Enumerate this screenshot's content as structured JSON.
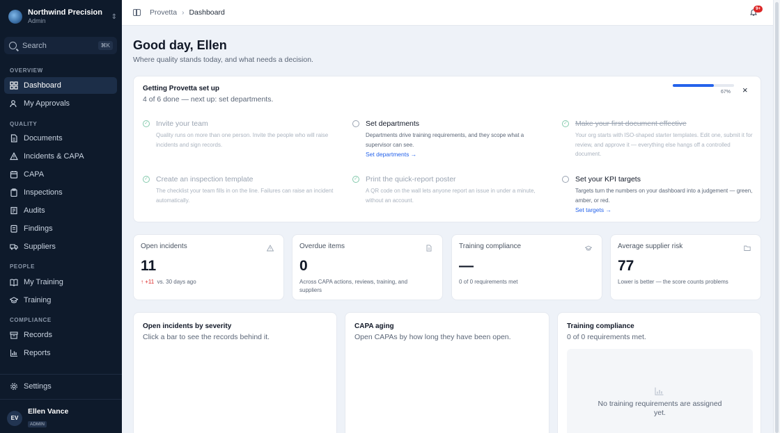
{
  "org": {
    "name": "Northwind Precision",
    "role": "Admin",
    "chevron_icon": "chevron-up-down-icon"
  },
  "search": {
    "label": "Search",
    "shortcut": "⌘K"
  },
  "nav": {
    "sections": [
      "OVERVIEW",
      "QUALITY",
      "PEOPLE",
      "COMPLIANCE"
    ],
    "items": [
      {
        "label": "Dashboard",
        "icon": "dashboard-icon",
        "active": true
      },
      {
        "label": "My Approvals",
        "icon": "user-check-icon"
      },
      {
        "label": "Documents",
        "icon": "document-icon"
      },
      {
        "label": "Incidents & CAPA",
        "icon": "warning-icon"
      },
      {
        "label": "CAPA",
        "icon": "capa-icon"
      },
      {
        "label": "Inspections",
        "icon": "clipboard-icon"
      },
      {
        "label": "Audits",
        "icon": "audit-icon"
      },
      {
        "label": "Findings",
        "icon": "findings-icon"
      },
      {
        "label": "Suppliers",
        "icon": "truck-icon"
      },
      {
        "label": "My Training",
        "icon": "book-icon"
      },
      {
        "label": "Training",
        "icon": "graduation-cap-icon"
      },
      {
        "label": "Records",
        "icon": "archive-icon"
      },
      {
        "label": "Reports",
        "icon": "bar-chart-icon"
      }
    ],
    "settings": "Settings"
  },
  "user": {
    "initials": "EV",
    "name": "Ellen Vance",
    "role": "ADMIN"
  },
  "breadcrumb": {
    "root": "Provetta",
    "separator": "›",
    "current": "Dashboard"
  },
  "notifications": {
    "badge": "9+",
    "icon": "bell-icon"
  },
  "greeting": {
    "title": "Good day, Ellen",
    "subtitle": "Where quality stands today, and what needs a decision."
  },
  "setup": {
    "title": "Getting Provetta set up",
    "subtitle": "4 of 6 done — next up: set departments.",
    "progress_percent": 67,
    "progress_label": "67%",
    "close": "×",
    "tasks": [
      {
        "title": "Invite your team",
        "desc": "Quality runs on more than one person. Invite the people who will raise incidents and sign records.",
        "done": true
      },
      {
        "title": "Set departments",
        "desc": "Departments drive training requirements, and they scope what a supervisor can see.",
        "done": false,
        "link": "Set departments →"
      },
      {
        "title": "Make your first document effective",
        "desc": "Your org starts with ISO-shaped starter templates. Edit one, submit it for review, and approve it — everything else hangs off a controlled document.",
        "done": true
      },
      {
        "title": "Create an inspection template",
        "desc": "The checklist your team fills in on the line. Failures can raise an incident automatically.",
        "done": true
      },
      {
        "title": "Print the quick-report poster",
        "desc": "A QR code on the wall lets anyone report an issue in under a minute, without an account.",
        "done": true
      },
      {
        "title": "Set your KPI targets",
        "desc": "Targets turn the numbers on your dashboard into a judgement — green, amber, or red.",
        "done": false,
        "link": "Set targets →"
      }
    ]
  },
  "stats": [
    {
      "title": "Open incidents",
      "icon": "warning-icon",
      "value": "11",
      "delta": "+11",
      "note": "vs. 30 days ago"
    },
    {
      "title": "Overdue items",
      "icon": "document-icon",
      "value": "0",
      "note": "Across CAPA actions, reviews, training, and suppliers"
    },
    {
      "title": "Training compliance",
      "icon": "graduation-cap-icon",
      "value": "—",
      "note": "0 of 0 requirements met"
    },
    {
      "title": "Average supplier risk",
      "icon": "folder-icon",
      "value": "77",
      "note": "Lower is better — the score counts problems"
    }
  ],
  "panels": [
    {
      "title": "Open incidents by severity",
      "subtitle": "Click a bar to see the records behind it."
    },
    {
      "title": "CAPA aging",
      "subtitle": "Open CAPAs by how long they have been open."
    },
    {
      "title": "Training compliance",
      "subtitle": "0 of 0 requirements met.",
      "empty_icon": "bar-chart-icon",
      "empty_text": "No training requirements are assigned yet."
    }
  ],
  "colors": {
    "sidebar": "#0e1a2b",
    "accent": "#2563eb",
    "danger": "#dc2626",
    "success": "#22a06b"
  }
}
